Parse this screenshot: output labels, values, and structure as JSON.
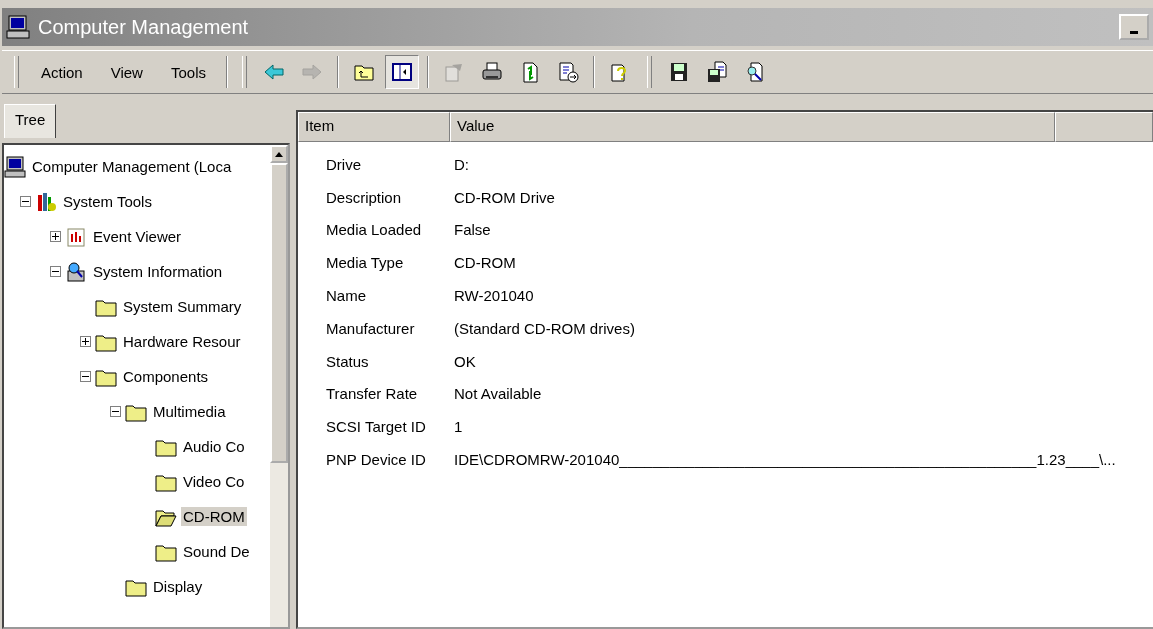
{
  "window": {
    "title": "Computer Management"
  },
  "menu": [
    {
      "label": "Action"
    },
    {
      "label": "View"
    },
    {
      "label": "Tools"
    }
  ],
  "toolbar": [
    {
      "kind": "back",
      "disabled": false,
      "pressed": false
    },
    {
      "kind": "forward",
      "disabled": true,
      "pressed": false
    },
    {
      "kind": "sep"
    },
    {
      "kind": "up",
      "disabled": false,
      "pressed": false
    },
    {
      "kind": "tree",
      "disabled": false,
      "pressed": true
    },
    {
      "kind": "sep"
    },
    {
      "kind": "properties",
      "disabled": true,
      "pressed": false
    },
    {
      "kind": "print",
      "disabled": false,
      "pressed": false
    },
    {
      "kind": "refresh",
      "disabled": false,
      "pressed": false
    },
    {
      "kind": "export",
      "disabled": false,
      "pressed": false
    },
    {
      "kind": "sep"
    },
    {
      "kind": "help",
      "disabled": false,
      "pressed": false
    },
    {
      "kind": "grip"
    },
    {
      "kind": "save",
      "disabled": false,
      "pressed": false
    },
    {
      "kind": "saveas",
      "disabled": false,
      "pressed": false
    },
    {
      "kind": "find",
      "disabled": false,
      "pressed": false
    }
  ],
  "tabs": [
    {
      "label": "Tree",
      "selected": true
    }
  ],
  "tree": [
    {
      "label": "Computer Management (Loca",
      "kind": "computer",
      "selected": false,
      "children": [
        {
          "label": "System Tools",
          "kind": "tools",
          "expanded": true,
          "selected": false,
          "children": [
            {
              "label": "Event Viewer",
              "kind": "event",
              "expanded": false,
              "selected": false
            },
            {
              "label": "System Information",
              "kind": "sysinfo",
              "expanded": true,
              "selected": false,
              "children": [
                {
                  "label": "System Summary",
                  "kind": "folder",
                  "selected": false
                },
                {
                  "label": "Hardware Resour",
                  "kind": "folder",
                  "expanded": false,
                  "selected": false
                },
                {
                  "label": "Components",
                  "kind": "folder",
                  "expanded": true,
                  "selected": false,
                  "children": [
                    {
                      "label": "Multimedia",
                      "kind": "folder",
                      "expanded": true,
                      "selected": false,
                      "children": [
                        {
                          "label": "Audio Co",
                          "kind": "folder",
                          "selected": false
                        },
                        {
                          "label": "Video Co",
                          "kind": "folder",
                          "selected": false
                        },
                        {
                          "label": "CD-ROM",
                          "kind": "folder",
                          "selected": true
                        },
                        {
                          "label": "Sound De",
                          "kind": "folder",
                          "selected": false
                        }
                      ]
                    },
                    {
                      "label": "Display",
                      "kind": "folder",
                      "selected": false
                    }
                  ]
                }
              ]
            }
          ]
        }
      ]
    }
  ],
  "table": {
    "columns": [
      "Item",
      "Value"
    ],
    "rows": [
      [
        "Drive",
        "D:"
      ],
      [
        "Description",
        "CD-ROM Drive"
      ],
      [
        "Media Loaded",
        "False"
      ],
      [
        "Media Type",
        "CD-ROM"
      ],
      [
        "Name",
        "RW-201040"
      ],
      [
        "Manufacturer",
        "(Standard CD-ROM drives)"
      ],
      [
        "Status",
        "OK"
      ],
      [
        "Transfer Rate",
        "Not Available"
      ],
      [
        "SCSI Target ID",
        "1"
      ],
      [
        "PNP Device ID",
        "IDE\\CDROMRW-201040__________________________________________________1.23____\\..."
      ]
    ]
  }
}
